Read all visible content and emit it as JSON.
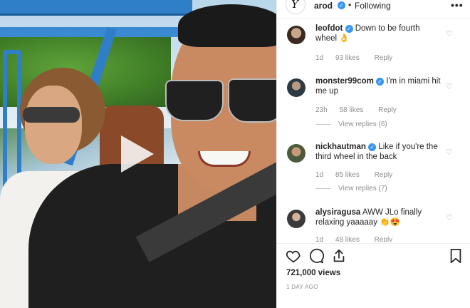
{
  "post": {
    "username": "arod",
    "follow_status": "Following",
    "separator": "•",
    "more_label": "•••",
    "views": "721,000 views",
    "time_ago": "1 DAY AGO"
  },
  "comments": [
    {
      "username": "leofdot",
      "verified": true,
      "text": "Down to be fourth wheel 👌",
      "time": "1d",
      "likes": "93 likes",
      "reply_label": "Reply",
      "view_replies": ""
    },
    {
      "username": "monster99com",
      "verified": true,
      "text": "I'm in miami hit me up",
      "time": "23h",
      "likes": "58 likes",
      "reply_label": "Reply",
      "view_replies": "View replies (6)"
    },
    {
      "username": "nickhautman",
      "verified": true,
      "text": "Like if you're the third wheel in the back",
      "time": "1d",
      "likes": "85 likes",
      "reply_label": "Reply",
      "view_replies": "View replies (7)"
    },
    {
      "username": "alysiragusa",
      "verified": false,
      "text": "AWW JLo finally relaxing yaaaaay 👏😍",
      "time": "1d",
      "likes": "48 likes",
      "reply_label": "Reply",
      "view_replies": ""
    }
  ],
  "icons": {
    "verified": "verified-badge-icon",
    "heart": "heart-icon",
    "comment": "comment-icon",
    "share": "share-icon",
    "bookmark": "bookmark-icon",
    "play": "play-icon"
  },
  "colors": {
    "verified_blue": "#3897f0",
    "text_primary": "#262626",
    "text_secondary": "#8e8e8e"
  }
}
